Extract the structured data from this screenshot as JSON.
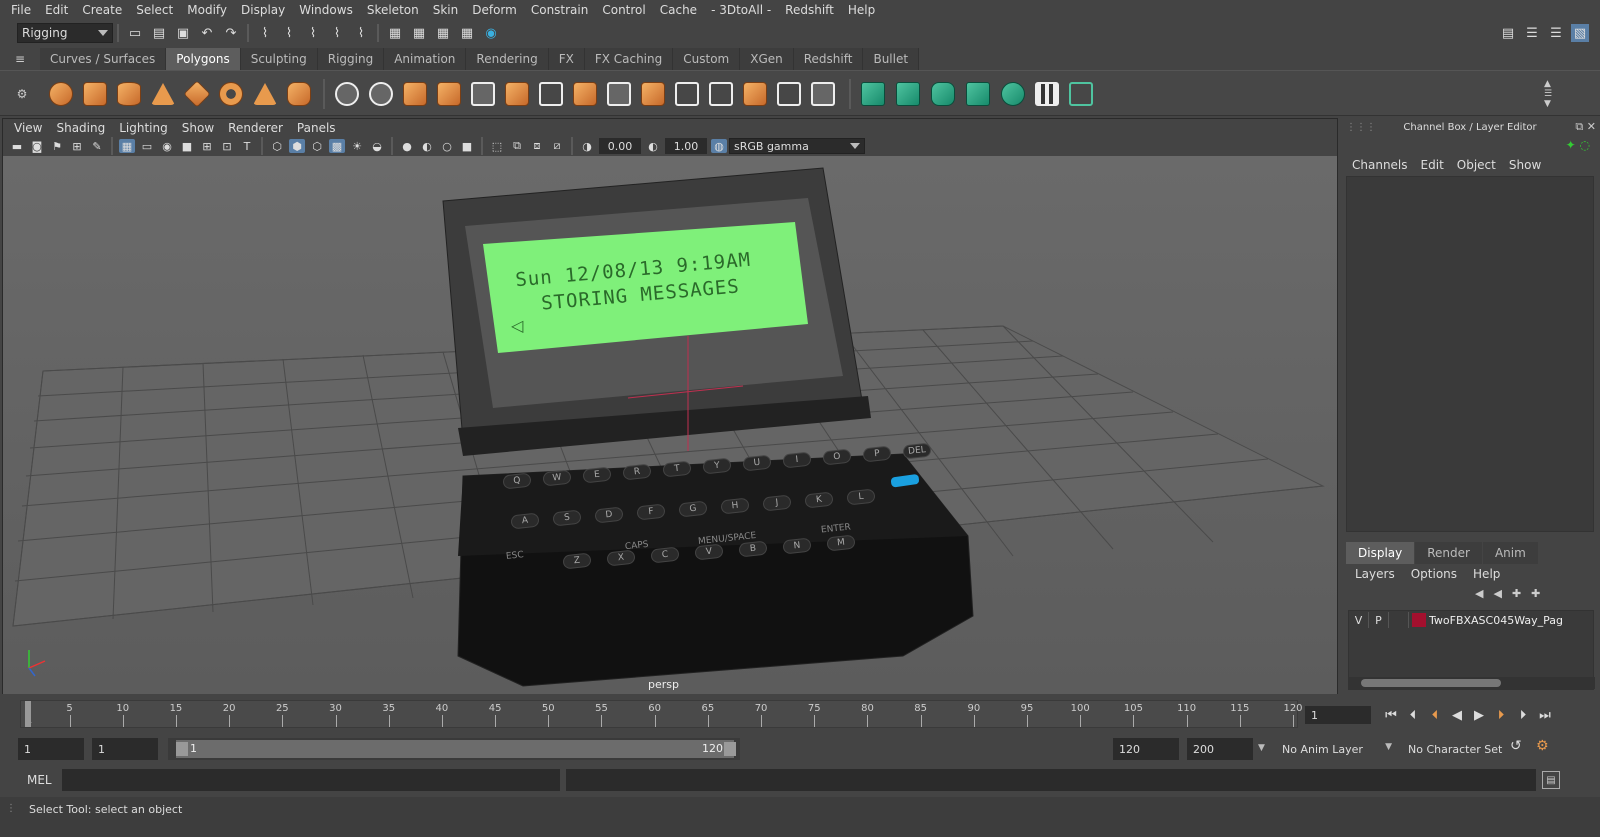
{
  "menubar": [
    "File",
    "Edit",
    "Create",
    "Select",
    "Modify",
    "Display",
    "Windows",
    "Skeleton",
    "Skin",
    "Deform",
    "Constrain",
    "Control",
    "Cache",
    "- 3DtoAll -",
    "Redshift",
    "Help"
  ],
  "status": {
    "mode": "Rigging"
  },
  "shelf_tabs": [
    "Curves / Surfaces",
    "Polygons",
    "Sculpting",
    "Rigging",
    "Animation",
    "Rendering",
    "FX",
    "FX Caching",
    "Custom",
    "XGen",
    "Redshift",
    "Bullet"
  ],
  "shelf_active": "Polygons",
  "viewport": {
    "menu": [
      "View",
      "Shading",
      "Lighting",
      "Show",
      "Renderer",
      "Panels"
    ],
    "exposure": "0.00",
    "gamma": "1.00",
    "colorspace": "sRGB gamma",
    "camera": "persp",
    "screen_line1": "Sun 12/08/13  9:19AM",
    "screen_line2": "STORING MESSAGES",
    "keys_row1": [
      "Q",
      "W",
      "E",
      "R",
      "T",
      "Y",
      "U",
      "I",
      "O",
      "P",
      "DEL"
    ],
    "keys_row2": [
      "A",
      "S",
      "D",
      "F",
      "G",
      "H",
      "J",
      "K",
      "L"
    ],
    "keys_row3": [
      "Z",
      "X",
      "C",
      "V",
      "B",
      "N",
      "M"
    ],
    "key_esc": "ESC",
    "key_caps": "CAPS",
    "key_menu": "MENU/SPACE",
    "key_enter": "ENTER"
  },
  "channelbox": {
    "title": "Channel Box / Layer Editor",
    "menu": [
      "Channels",
      "Edit",
      "Object",
      "Show"
    ]
  },
  "layers": {
    "tabs": [
      "Display",
      "Render",
      "Anim"
    ],
    "active_tab": "Display",
    "menu": [
      "Layers",
      "Options",
      "Help"
    ],
    "row": {
      "v": "V",
      "p": "P",
      "name": "TwoFBXASC045Way_Pag",
      "color": "#a3102e"
    }
  },
  "timeline": {
    "ticks": [
      "1",
      "5",
      "10",
      "15",
      "20",
      "25",
      "30",
      "35",
      "40",
      "45",
      "50",
      "55",
      "60",
      "65",
      "70",
      "75",
      "80",
      "85",
      "90",
      "95",
      "100",
      "105",
      "110",
      "115",
      "120"
    ],
    "current_frame": "1"
  },
  "range": {
    "start": "1",
    "start2": "1",
    "bar_start": "1",
    "bar_end": "120",
    "end": "120",
    "end2": "200",
    "anim_layer": "No Anim Layer",
    "char_set": "No Character Set"
  },
  "cmdline": {
    "label": "MEL"
  },
  "helpline": {
    "text": "Select Tool: select an object"
  },
  "colors": {
    "accent": "#5d5d5d",
    "screen": "#7ff07a",
    "layer": "#a3102e"
  }
}
